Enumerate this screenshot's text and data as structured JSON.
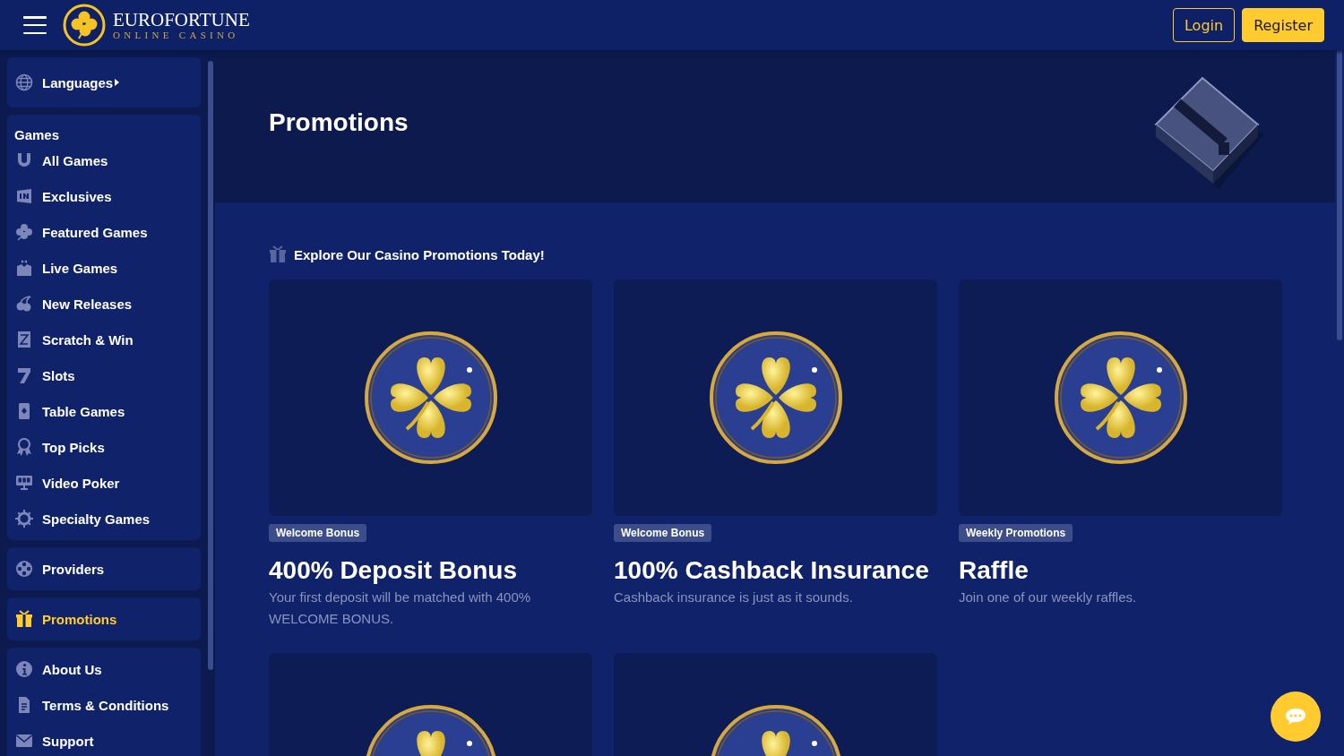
{
  "header": {
    "logo_title": "EUROFORTUNE",
    "logo_subtitle": "ONLINE CASINO",
    "buttons": [
      {
        "label": "Login",
        "kind": "outline"
      },
      {
        "label": "Register",
        "kind": "filled"
      }
    ]
  },
  "sidebar": {
    "groups": [
      {
        "items": [
          {
            "label": "Languages",
            "kind": "submenu",
            "selected": false
          }
        ]
      },
      {
        "heading": "Games",
        "items": [
          {
            "label": "All Games",
            "kind": "link",
            "selected": false
          },
          {
            "label": "Exclusives",
            "kind": "link",
            "selected": false
          },
          {
            "label": "Featured Games",
            "kind": "link",
            "selected": false
          },
          {
            "label": "Live Games",
            "kind": "link",
            "selected": false
          },
          {
            "label": "New Releases",
            "kind": "link",
            "selected": false
          },
          {
            "label": "Scratch & Win",
            "kind": "link",
            "selected": false
          },
          {
            "label": "Slots",
            "kind": "link",
            "selected": false
          },
          {
            "label": "Table Games",
            "kind": "link",
            "selected": false
          },
          {
            "label": "Top Picks",
            "kind": "link",
            "selected": false
          },
          {
            "label": "Video Poker",
            "kind": "link",
            "selected": false
          },
          {
            "label": "Specialty Games",
            "kind": "link",
            "selected": false
          }
        ]
      },
      {
        "items": [
          {
            "label": "Providers",
            "kind": "link",
            "selected": false
          }
        ]
      },
      {
        "items": [
          {
            "label": "Promotions",
            "kind": "link",
            "selected": true
          }
        ]
      },
      {
        "items": [
          {
            "label": "About Us",
            "kind": "link",
            "selected": false
          },
          {
            "label": "Terms & Conditions",
            "kind": "link",
            "selected": false
          },
          {
            "label": "Support",
            "kind": "link",
            "selected": false
          }
        ]
      }
    ]
  },
  "main": {
    "hero_title": "Promotions",
    "section_title": "Explore Our Casino Promotions Today!",
    "promotions": [
      {
        "kind": "full",
        "tag": "Welcome Bonus",
        "title": "400% Deposit Bonus",
        "description": "Your first deposit will be matched with 400% WELCOME BONUS."
      },
      {
        "kind": "full",
        "tag": "Welcome Bonus",
        "title": "100% Cashback Insurance",
        "description": "Cashback insurance is just as it sounds."
      },
      {
        "kind": "full",
        "tag": "Weekly Promotions",
        "title": "Raffle",
        "description": "Join one of our weekly raffles."
      },
      {
        "kind": "image-only"
      },
      {
        "kind": "image-only"
      }
    ]
  }
}
